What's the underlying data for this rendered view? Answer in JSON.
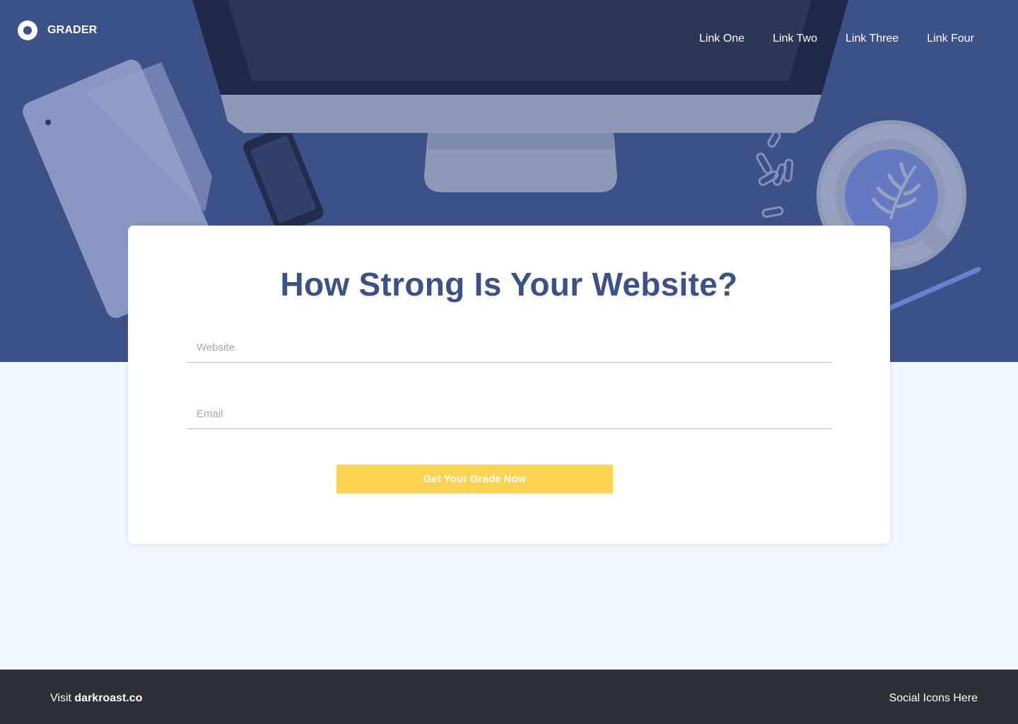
{
  "brand": {
    "name": "GRADER"
  },
  "nav": {
    "links": [
      "Link One",
      "Link Two",
      "Link Three",
      "Link Four"
    ]
  },
  "form": {
    "title": "How Strong Is Your Website?",
    "website_placeholder": "Website",
    "email_placeholder": "Email",
    "submit_label": "Get Your Grade Now"
  },
  "footer": {
    "visit_prefix": "Visit",
    "visit_site": "darkroast.co",
    "social_text": "Social Icons Here"
  },
  "colors": {
    "hero_bg": "#3d5189",
    "accent_button": "#fed351",
    "page_bg": "#f2f6fe",
    "footer_bg": "#2f3035",
    "title_color": "#3d5189"
  }
}
